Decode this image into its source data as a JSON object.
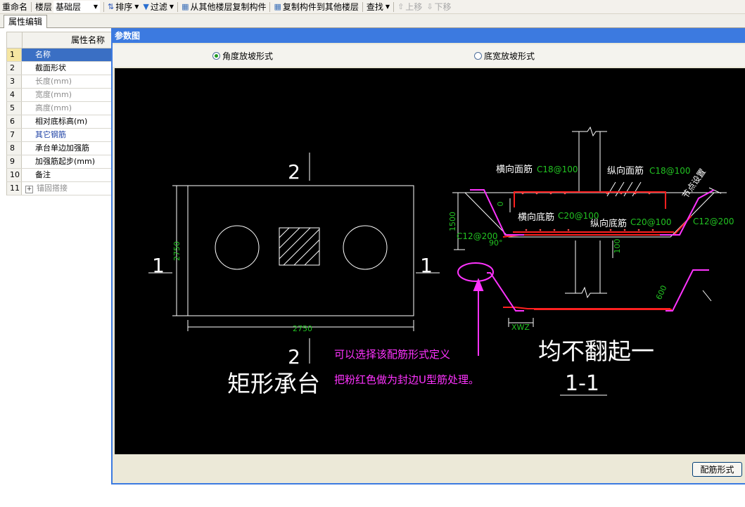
{
  "toolbar": {
    "rename": "重命名",
    "floor_label": "楼层",
    "floor_value": "基础层",
    "sort": "排序",
    "filter": "过滤",
    "copy_from": "从其他楼层复制构件",
    "copy_to": "复制构件到其他楼层",
    "find": "查找",
    "move_up": "上移",
    "move_down": "下移"
  },
  "panel": {
    "tab": "属性编辑",
    "column_header": "属性名称",
    "rows": [
      {
        "num": "1",
        "label": "名称"
      },
      {
        "num": "2",
        "label": "截面形状"
      },
      {
        "num": "3",
        "label": "长度(mm)"
      },
      {
        "num": "4",
        "label": "宽度(mm)"
      },
      {
        "num": "5",
        "label": "高度(mm)"
      },
      {
        "num": "6",
        "label": "相对底标高(m)"
      },
      {
        "num": "7",
        "label": "其它钢筋"
      },
      {
        "num": "8",
        "label": "承台单边加强筋"
      },
      {
        "num": "9",
        "label": "加强筋起步(mm)"
      },
      {
        "num": "10",
        "label": "备注"
      },
      {
        "num": "11",
        "label": "锚固搭接"
      }
    ]
  },
  "dialog": {
    "title": "参数图",
    "radio_angle": "角度放坡形式",
    "radio_width": "底宽放坡形式",
    "button": "配筋形式"
  },
  "drawing": {
    "plan": {
      "dim_vertical": "2750",
      "dim_horizontal": "2750",
      "sec_top": "2",
      "sec_bottom": "2",
      "sec_left": "1",
      "sec_right": "1",
      "title": "矩形承台"
    },
    "section": {
      "label_hface": "横向面筋",
      "label_hface_spec": "C18@100",
      "label_vface": "纵向面筋",
      "label_vface_spec": "C18@100",
      "label_hbottom": "横向底筋",
      "label_hbottom_spec": "C20@100",
      "label_vbottom": "纵向底筋",
      "label_vbottom_spec": "C20@100",
      "label_node": "节点设置",
      "dim_1500": "1500",
      "dim_0": "0",
      "dim_100": "100",
      "angle_90": "90°",
      "left_stirrup": "C12@200",
      "right_stirrup": "C12@200",
      "dim_600": "600",
      "dim_xwz": "XWZ",
      "note_line1": "可以选择该配筋形式定义",
      "note_line2": "把粉红色做为封边U型筋处理。",
      "heading": "均不翻起一",
      "section_name": "1-1"
    }
  },
  "colors": {
    "dialog_title": "#3c7ae0",
    "canvas_bg": "#000000",
    "rebar": "#ff2020",
    "annotation": "#ff33ff",
    "dimension": "#22c322",
    "selected_row": "#3a6fc4"
  }
}
